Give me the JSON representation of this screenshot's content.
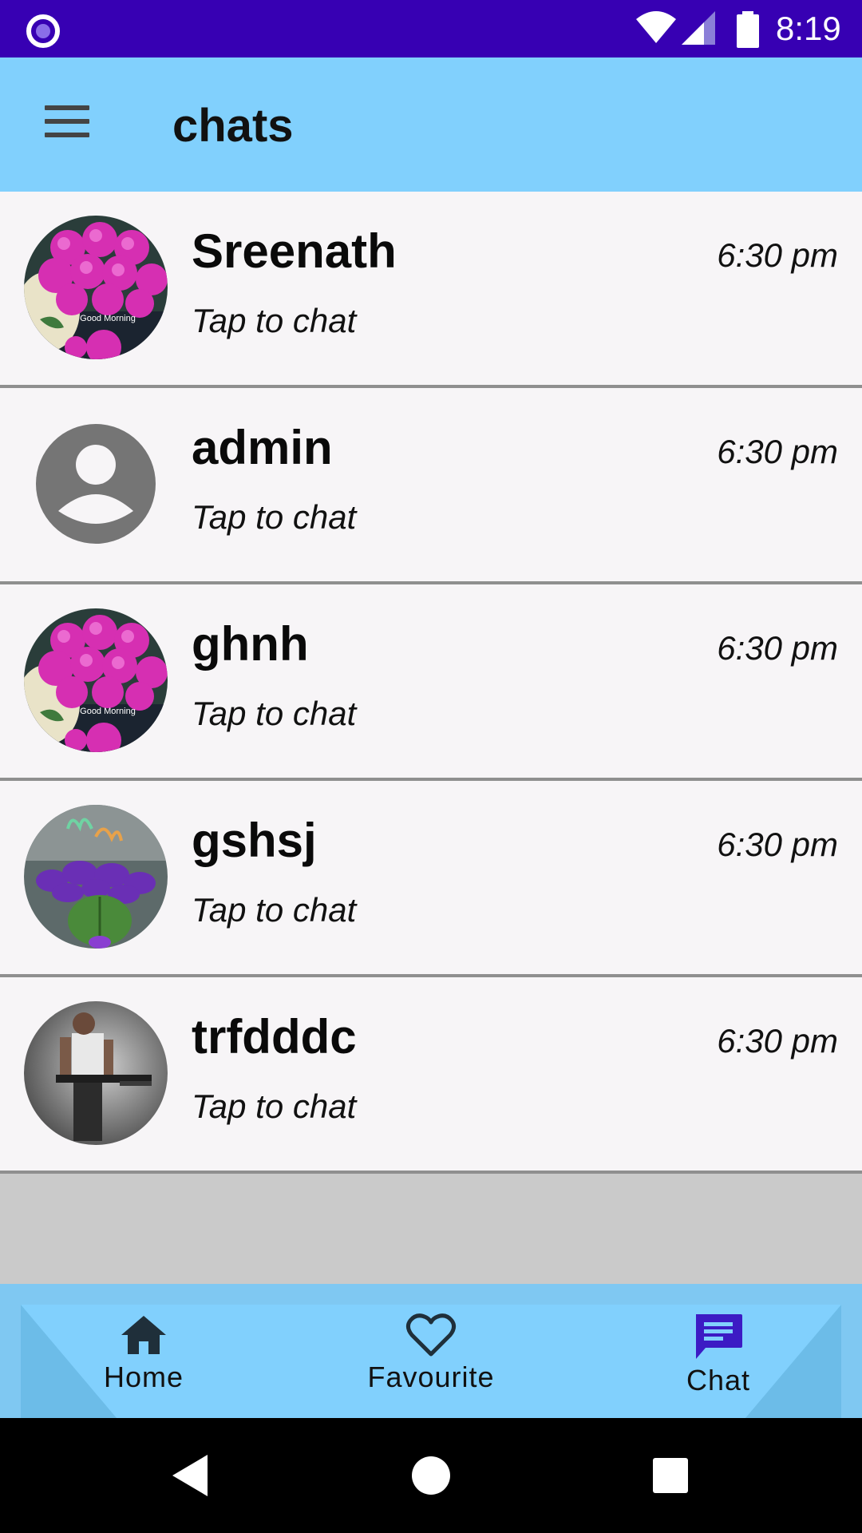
{
  "status_bar": {
    "time": "8:19"
  },
  "app_bar": {
    "title": "chats"
  },
  "chats": [
    {
      "name": "Sreenath",
      "subtitle": "Tap to chat",
      "time": "6:30 pm",
      "avatar": "roses-good-morning-photo",
      "avatar_caption": "Good Morning"
    },
    {
      "name": "admin",
      "subtitle": "Tap to chat",
      "time": "6:30 pm",
      "avatar": "default-person-icon"
    },
    {
      "name": "ghnh",
      "subtitle": "Tap to chat",
      "time": "6:30 pm",
      "avatar": "roses-good-morning-photo",
      "avatar_caption": "Good Morning"
    },
    {
      "name": "gshsj",
      "subtitle": "Tap to chat",
      "time": "6:30 pm",
      "avatar": "violets-good-morning-photo"
    },
    {
      "name": "trfdddc",
      "subtitle": "Tap to chat",
      "time": "6:30 pm",
      "avatar": "man-with-gun-photo"
    }
  ],
  "bottom_nav": {
    "items": [
      {
        "label": "Home",
        "icon": "home-icon"
      },
      {
        "label": "Favourite",
        "icon": "heart-outline-icon"
      },
      {
        "label": "Chat",
        "icon": "chat-icon",
        "active": true
      }
    ]
  },
  "colors": {
    "status_bar": "#3700b3",
    "app_bar": "#81d0fd",
    "list_bg": "#f7f5f7",
    "active_nav": "#3c1bc4"
  }
}
